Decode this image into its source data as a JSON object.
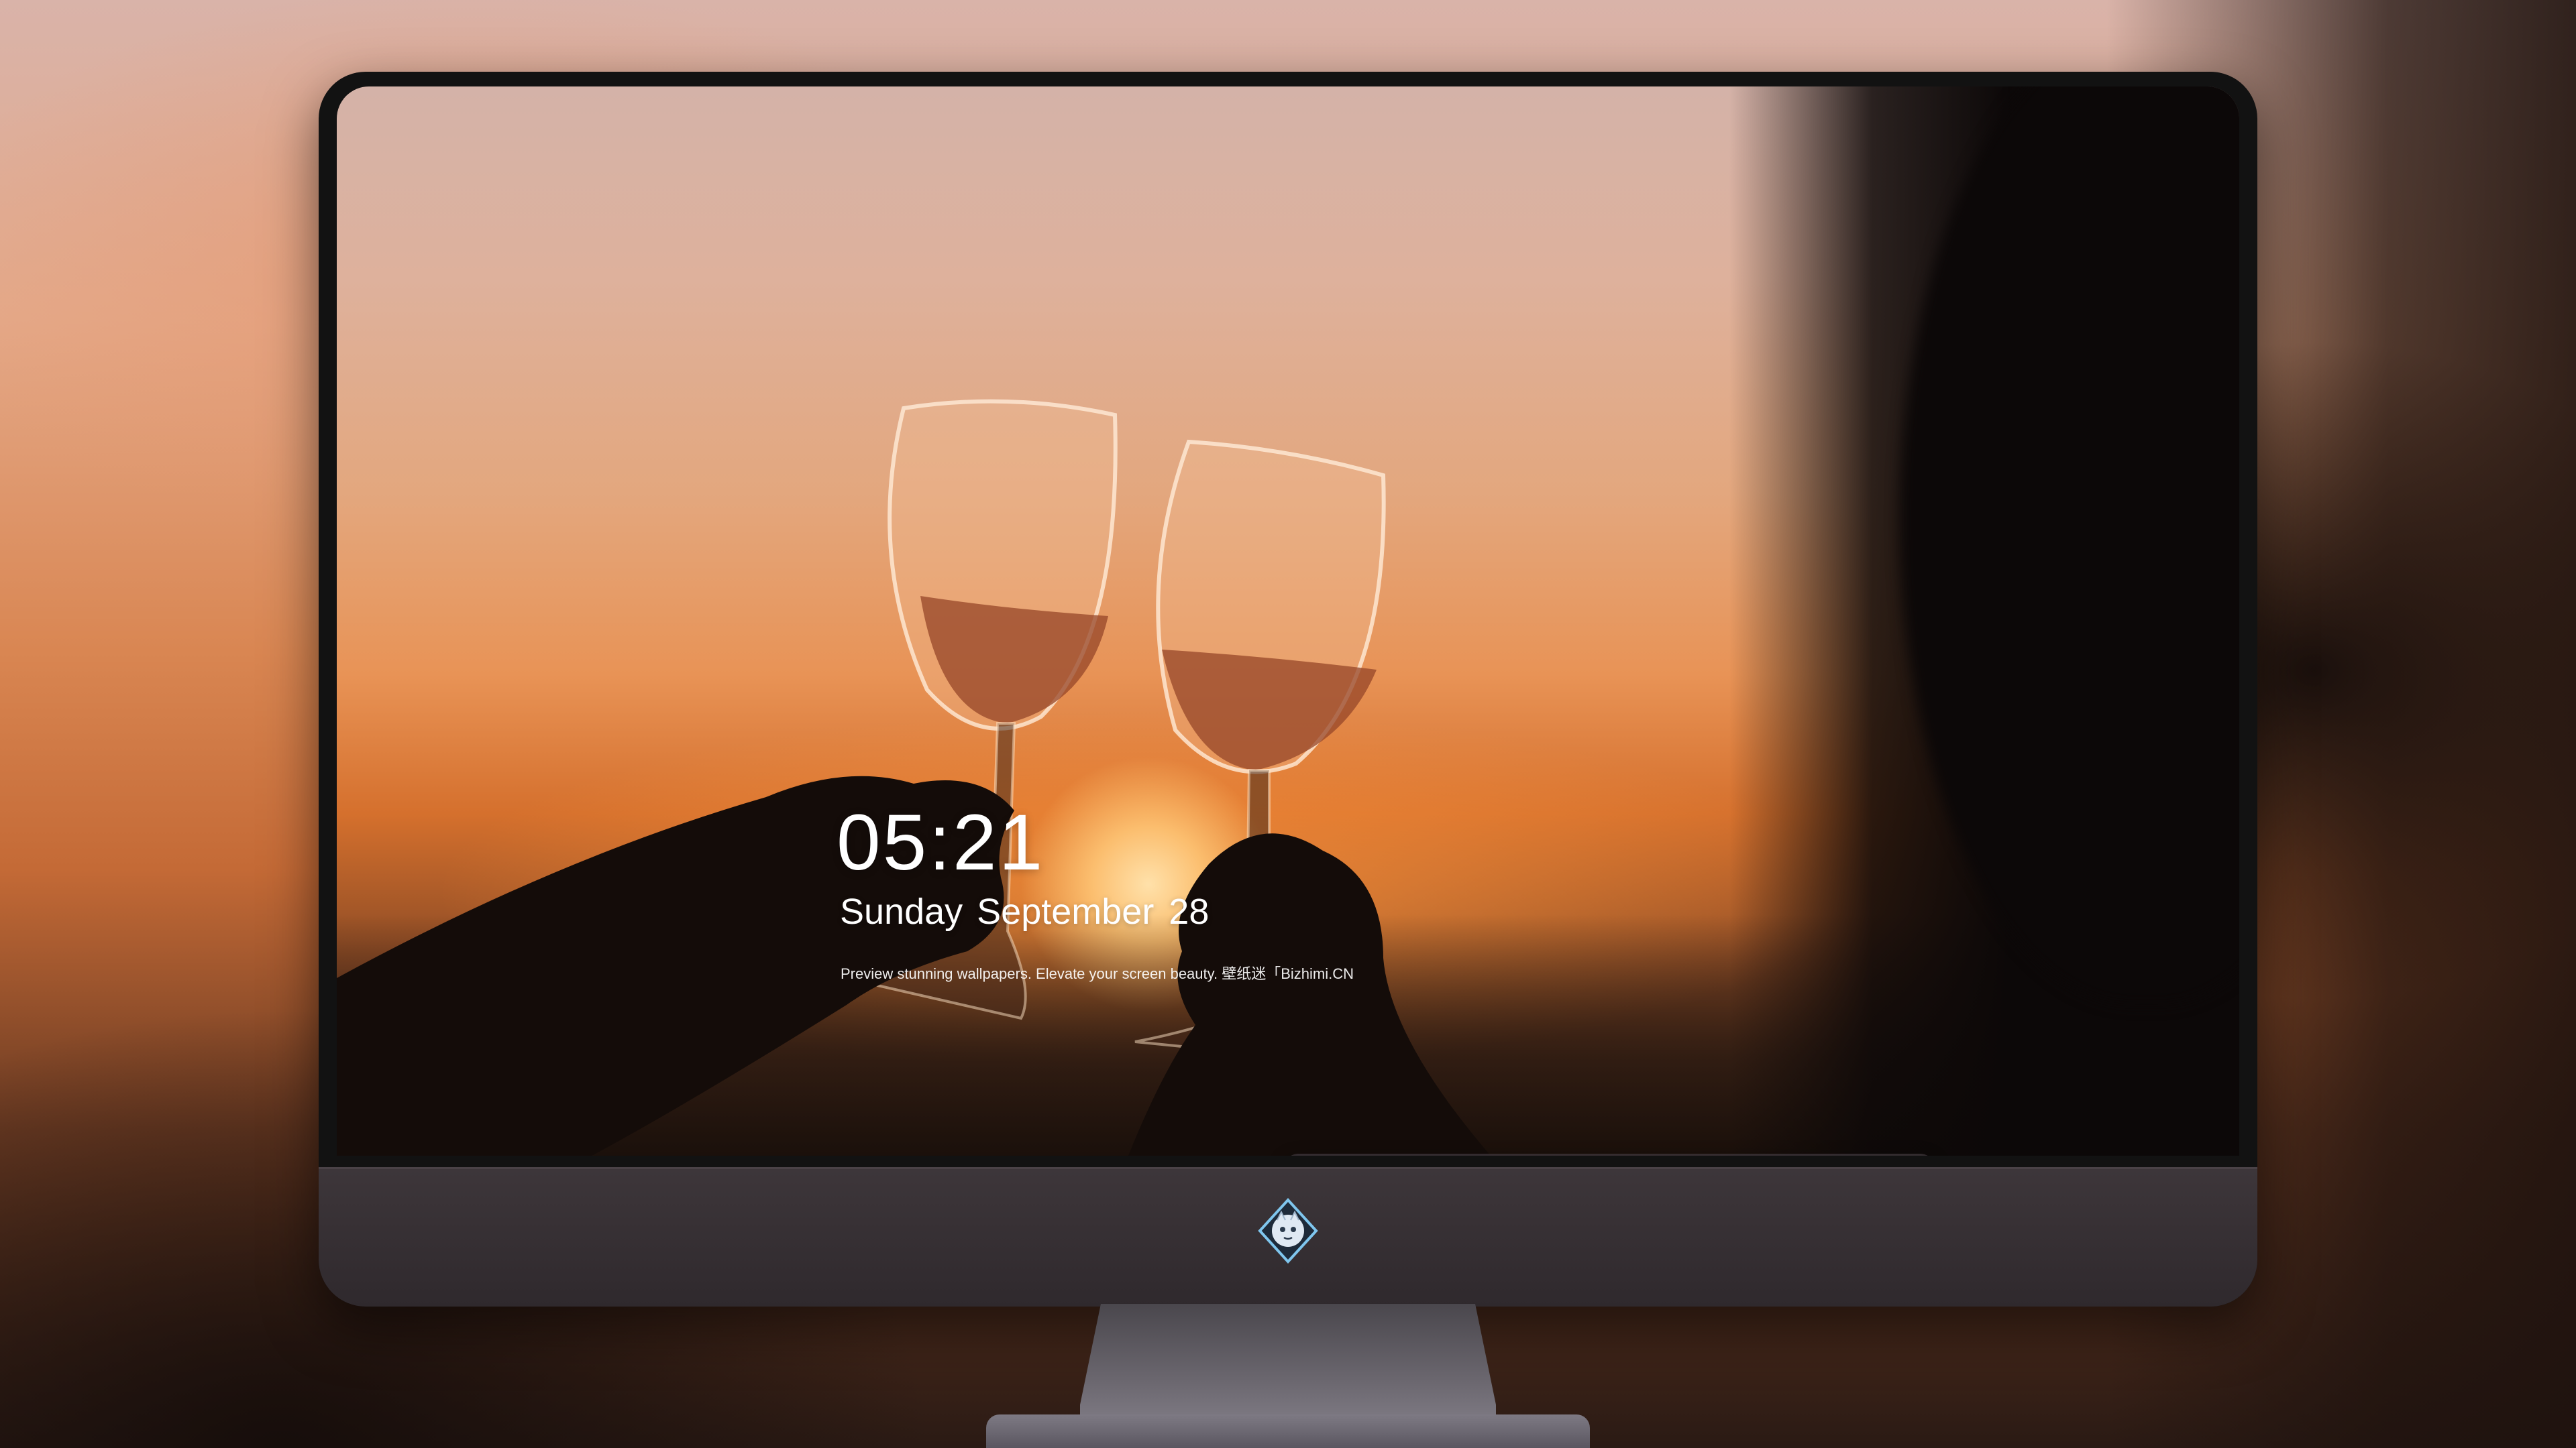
{
  "lock_screen": {
    "time": "05:21",
    "weekday_month": "Sunday September",
    "day": "28",
    "tagline": "Preview stunning wallpapers. Elevate your screen beauty. 壁纸迷「Bizhimi.CN"
  },
  "dock": {
    "apps": [
      {
        "icon": "messages-icon",
        "color": "#2ecc4a"
      },
      {
        "icon": "weather-icon",
        "color": "#2f9cf0"
      },
      {
        "icon": "clock-icon",
        "color": "#1c1c1e"
      },
      {
        "icon": "preview-icon",
        "color": "#f0c23a"
      },
      {
        "icon": "clapperboard-icon",
        "color": "#4fc3e8"
      },
      {
        "icon": "notes-icon",
        "color": "#f7d346"
      },
      {
        "icon": "photo-collage-icon",
        "color": "#3aa0e0"
      },
      {
        "icon": "music-icon",
        "color": "#c93bd8"
      },
      {
        "icon": "app-store-icon",
        "color": "#1e8ef0"
      },
      {
        "icon": "camera-icon",
        "color": "#8e8e93"
      }
    ]
  },
  "colors": {
    "monitor_frame": "#121212",
    "monitor_chin": "#3d363a",
    "sunset_orange": "#e89356"
  }
}
